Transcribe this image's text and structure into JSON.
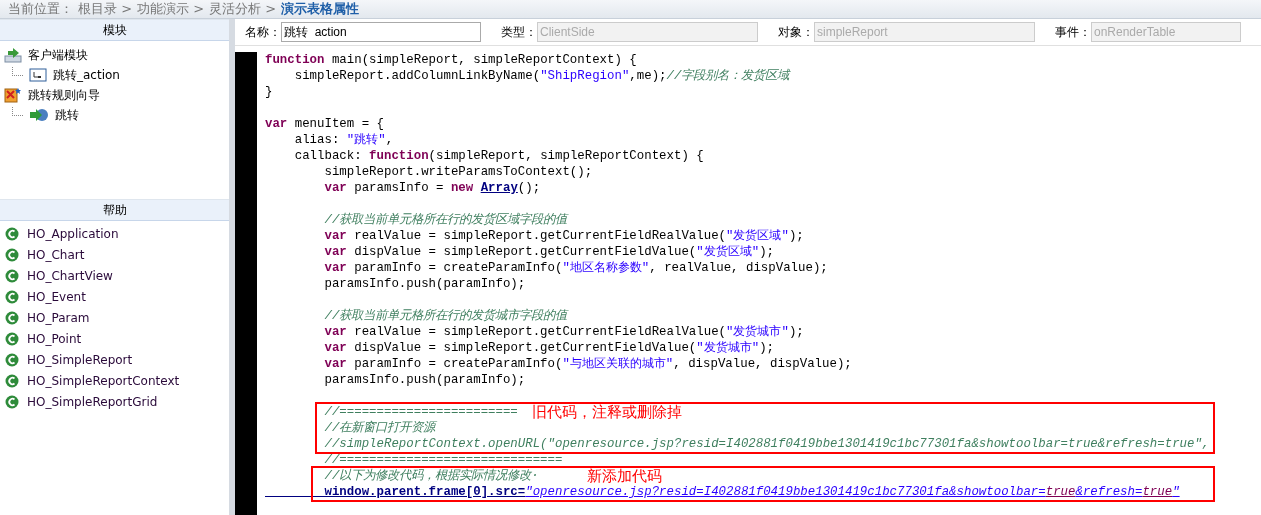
{
  "breadcrumb": {
    "label": "当前位置：",
    "path": [
      "根目录 >",
      "功能演示 >",
      "灵活分析 >"
    ],
    "current": "演示表格属性"
  },
  "modules": {
    "title": "模块",
    "tree": [
      {
        "label": "客户端模块",
        "kind": "module",
        "children": [
          {
            "label": "跳转_action",
            "kind": "action"
          }
        ]
      },
      {
        "label": "跳转规则向导",
        "kind": "wizard",
        "children": [
          {
            "label": "跳转",
            "kind": "jump"
          }
        ]
      }
    ]
  },
  "help": {
    "title": "帮助",
    "items": [
      "HO_Application",
      "HO_Chart",
      "HO_ChartView",
      "HO_Event",
      "HO_Param",
      "HO_Point",
      "HO_SimpleReport",
      "HO_SimpleReportContext",
      "HO_SimpleReportGrid"
    ]
  },
  "fields": [
    {
      "label": "名称：",
      "value": "跳转  action",
      "disabled": false
    },
    {
      "label": "类型：",
      "value": "ClientSide",
      "disabled": true
    },
    {
      "label": "对象：",
      "value": "simpleReport",
      "disabled": true
    },
    {
      "label": "事件：",
      "value": "onRenderTable",
      "disabled": true
    }
  ],
  "code": [
    {
      "kind": "code",
      "tokens": [
        {
          "kind": "kw",
          "text": "function"
        },
        {
          "kind": "plain",
          "text": " main(simpleReport, simpleReportContext) {"
        }
      ]
    },
    {
      "kind": "code",
      "tokens": [
        {
          "kind": "plain",
          "text": "    simpleReport.addColumnLinkByName("
        },
        {
          "kind": "str",
          "text": "\"ShipRegion\""
        },
        {
          "kind": "plain",
          "text": ",me);"
        },
        {
          "kind": "cmt",
          "text": "//字段别名：发货区域"
        }
      ]
    },
    {
      "kind": "code",
      "tokens": [
        {
          "kind": "plain",
          "text": "}"
        }
      ]
    },
    {
      "kind": "blank"
    },
    {
      "kind": "code",
      "tokens": [
        {
          "kind": "kw",
          "text": "var"
        },
        {
          "kind": "plain",
          "text": " menuItem = {"
        }
      ]
    },
    {
      "kind": "code",
      "tokens": [
        {
          "kind": "plain",
          "text": "    alias: "
        },
        {
          "kind": "str",
          "text": "\"跳转\""
        },
        {
          "kind": "plain",
          "text": ","
        }
      ]
    },
    {
      "kind": "code",
      "tokens": [
        {
          "kind": "plain",
          "text": "    callback: "
        },
        {
          "kind": "kw",
          "text": "function"
        },
        {
          "kind": "plain",
          "text": "(simpleReport, simpleReportContext) {"
        }
      ]
    },
    {
      "kind": "code",
      "tokens": [
        {
          "kind": "plain",
          "text": "        simpleReport.writeParamsToContext();"
        }
      ]
    },
    {
      "kind": "code",
      "tokens": [
        {
          "kind": "kw",
          "text": "        var"
        },
        {
          "kind": "plain",
          "text": " paramsInfo = "
        },
        {
          "kind": "kw",
          "text": "new "
        },
        {
          "kind": "type",
          "text": "Array"
        },
        {
          "kind": "plain",
          "text": "();"
        }
      ]
    },
    {
      "kind": "blank"
    },
    {
      "kind": "code",
      "tokens": [
        {
          "kind": "cmt",
          "text": "        //获取当前单元格所在行的发货区域字段的值"
        }
      ]
    },
    {
      "kind": "code",
      "tokens": [
        {
          "kind": "kw",
          "text": "        var"
        },
        {
          "kind": "plain",
          "text": " realValue = simpleReport.getCurrentFieldRealValue("
        },
        {
          "kind": "str",
          "text": "\"发货区域\""
        },
        {
          "kind": "plain",
          "text": ");"
        }
      ]
    },
    {
      "kind": "code",
      "tokens": [
        {
          "kind": "kw",
          "text": "        var"
        },
        {
          "kind": "plain",
          "text": " dispValue = simpleReport.getCurrentFieldValue("
        },
        {
          "kind": "str",
          "text": "\"发货区域\""
        },
        {
          "kind": "plain",
          "text": ");"
        }
      ]
    },
    {
      "kind": "code",
      "tokens": [
        {
          "kind": "kw",
          "text": "        var"
        },
        {
          "kind": "plain",
          "text": " paramInfo = createParamInfo("
        },
        {
          "kind": "str",
          "text": "\"地区名称参数\""
        },
        {
          "kind": "plain",
          "text": ", realValue, dispValue);"
        }
      ]
    },
    {
      "kind": "code",
      "tokens": [
        {
          "kind": "plain",
          "text": "        paramsInfo.push(paramInfo);"
        }
      ]
    },
    {
      "kind": "blank"
    },
    {
      "kind": "code",
      "tokens": [
        {
          "kind": "cmt",
          "text": "        //获取当前单元格所在行的发货城市字段的值"
        }
      ]
    },
    {
      "kind": "code",
      "tokens": [
        {
          "kind": "kw",
          "text": "        var"
        },
        {
          "kind": "plain",
          "text": " realValue = simpleReport.getCurrentFieldRealValue("
        },
        {
          "kind": "str",
          "text": "\"发货城市\""
        },
        {
          "kind": "plain",
          "text": ");"
        }
      ]
    },
    {
      "kind": "code",
      "tokens": [
        {
          "kind": "kw",
          "text": "        var"
        },
        {
          "kind": "plain",
          "text": " dispValue = simpleReport.getCurrentFieldValue("
        },
        {
          "kind": "str",
          "text": "\"发货城市\""
        },
        {
          "kind": "plain",
          "text": ");"
        }
      ]
    },
    {
      "kind": "code",
      "tokens": [
        {
          "kind": "kw",
          "text": "        var"
        },
        {
          "kind": "plain",
          "text": " paramInfo = createParamInfo("
        },
        {
          "kind": "str",
          "text": "\"与地区关联的城市\""
        },
        {
          "kind": "plain",
          "text": ", dispValue, dispValue);"
        }
      ]
    },
    {
      "kind": "code",
      "tokens": [
        {
          "kind": "plain",
          "text": "        paramsInfo.push(paramInfo);"
        }
      ]
    },
    {
      "kind": "blank"
    },
    {
      "kind": "code",
      "tokens": [
        {
          "kind": "cmt",
          "text": "        //========================"
        }
      ]
    },
    {
      "kind": "code",
      "tokens": [
        {
          "kind": "cmt",
          "text": "        //在新窗口打开资源"
        }
      ]
    },
    {
      "kind": "code",
      "tokens": [
        {
          "kind": "cmt",
          "text": "        //simpleReportContext.openURL(\"openresource.jsp?resid=I402881f0419bbe1301419c1bc77301fa&showtoolbar=true&refresh=true\","
        }
      ]
    },
    {
      "kind": "code",
      "tokens": [
        {
          "kind": "cmt",
          "text": "        //=============================="
        }
      ]
    },
    {
      "kind": "code",
      "tokens": [
        {
          "kind": "cmt",
          "text": "        //以下为修改代码，根据实际情况修改·"
        }
      ]
    },
    {
      "kind": "code",
      "tokens": [
        {
          "kind": "link",
          "text": "        window.parent.frame[0].src="
        },
        {
          "kind": "linkstr",
          "text": "\"openresource.jsp?resid=I402881f0419bbe1301419c1bc77301fa&showtoolbar="
        },
        {
          "kind": "linkkw",
          "text": "true"
        },
        {
          "kind": "linkstr",
          "text": "&refresh="
        },
        {
          "kind": "linkkw",
          "text": "true"
        },
        {
          "kind": "linkstr",
          "text": "\""
        }
      ]
    }
  ],
  "annotations": [
    {
      "text": "旧代码，注释或删除掉",
      "kind": "old"
    },
    {
      "text": "新添加代码",
      "kind": "new"
    }
  ]
}
